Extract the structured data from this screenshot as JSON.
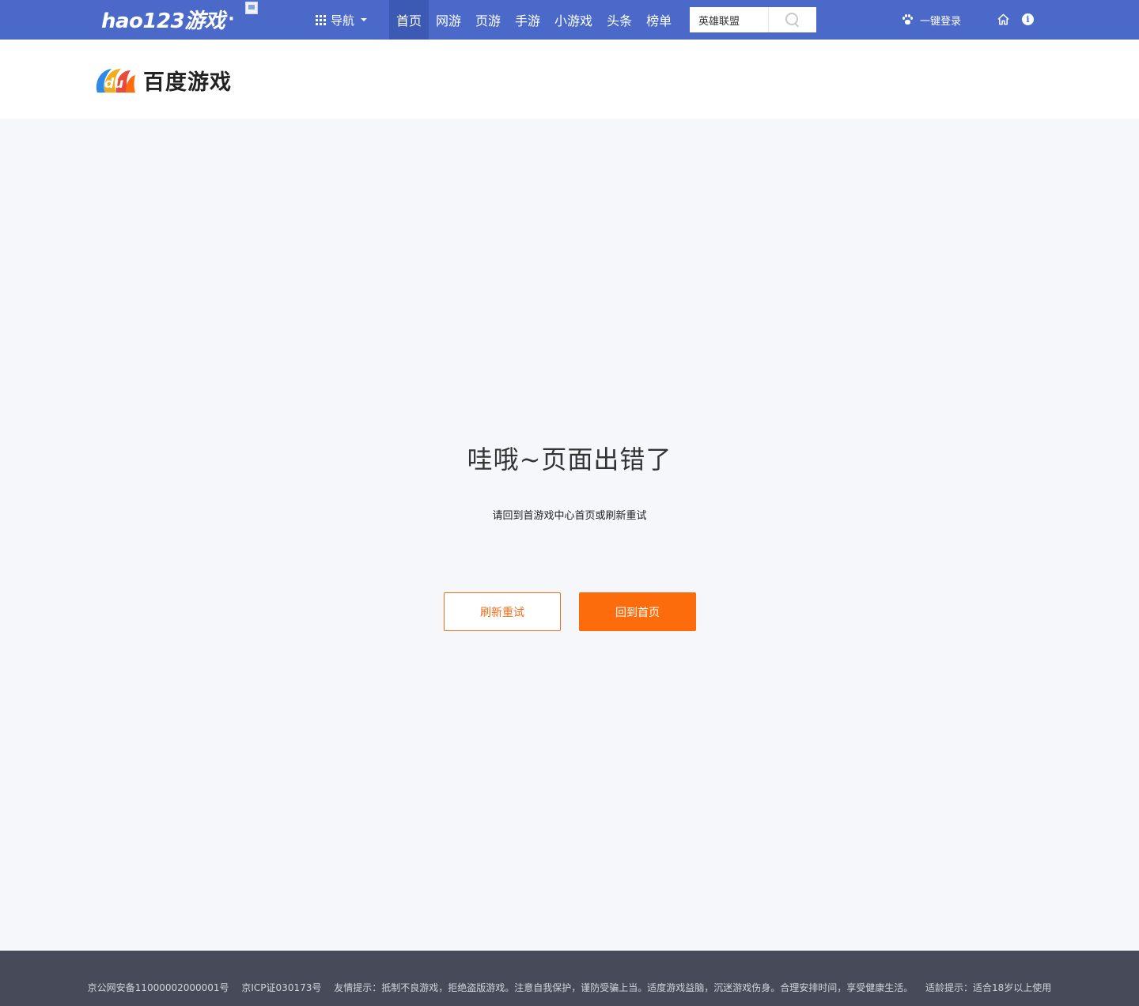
{
  "topbar": {
    "brand": "hao123游戏",
    "brand_dot": "·",
    "nav_label": "导航",
    "menu": [
      {
        "label": "首页",
        "active": true
      },
      {
        "label": "网游",
        "active": false
      },
      {
        "label": "页游",
        "active": false
      },
      {
        "label": "手游",
        "active": false
      },
      {
        "label": "小游戏",
        "active": false
      },
      {
        "label": "头条",
        "active": false
      },
      {
        "label": "榜单",
        "active": false
      }
    ],
    "search": {
      "value": "英雄联盟",
      "icon": "search-icon"
    },
    "login_label": "一键登录",
    "icons": [
      "paw-icon",
      "home-icon",
      "info-icon"
    ],
    "info_glyph": "i",
    "bg_color": "#4a69c9"
  },
  "header": {
    "logo_text": "百度游戏",
    "logo_mark": "du"
  },
  "error": {
    "title": "哇哦~页面出错了",
    "subtitle": "请回到首游戏中心首页或刷新重试",
    "refresh_label": "刷新重试",
    "home_label": "回到首页",
    "accent_color": "#fc6c0c"
  },
  "footer": {
    "police_record": "京公网安备11000002000001号",
    "icp": "京ICP证030173号",
    "friendly_tip": "友情提示：抵制不良游戏，拒绝盗版游戏。注意自我保护，谨防受骗上当。适度游戏益脑，沉迷游戏伤身。合理安排时间，享受健康生活。",
    "age_tip": "适龄提示：适合18岁以上使用"
  }
}
